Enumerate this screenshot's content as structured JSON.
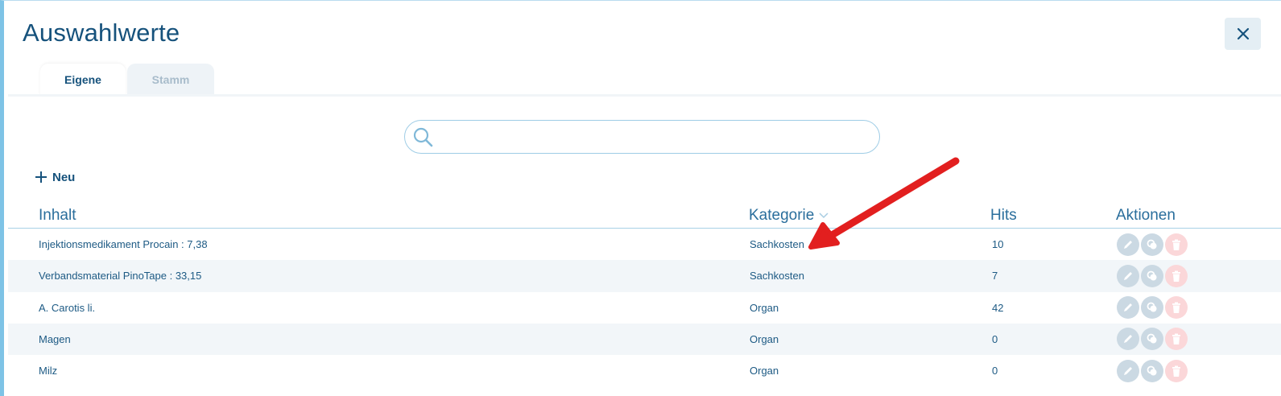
{
  "dialog": {
    "title": "Auswahlwerte",
    "close_icon": "close-icon"
  },
  "tabs": [
    {
      "label": "Eigene",
      "active": true
    },
    {
      "label": "Stamm",
      "active": false
    }
  ],
  "search": {
    "placeholder": "",
    "value": "",
    "icon": "search-icon"
  },
  "toolbar": {
    "new_label": "Neu",
    "new_icon": "plus-icon"
  },
  "table": {
    "columns": {
      "inhalt": "Inhalt",
      "kategorie": "Kategorie",
      "hits": "Hits",
      "aktionen": "Aktionen"
    },
    "sort_icon": "chevron-down-icon",
    "rows": [
      {
        "inhalt": "Injektionsmedikament Procain  : 7,38",
        "kategorie": "Sachkosten",
        "hits": "10"
      },
      {
        "inhalt": "Verbandsmaterial PinoTape : 33,15",
        "kategorie": "Sachkosten",
        "hits": "7"
      },
      {
        "inhalt": "A. Carotis li.",
        "kategorie": "Organ",
        "hits": "42"
      },
      {
        "inhalt": "Magen",
        "kategorie": "Organ",
        "hits": "0"
      },
      {
        "inhalt": "Milz",
        "kategorie": "Organ",
        "hits": "0"
      }
    ],
    "action_icons": [
      "pencil-icon",
      "copy-icon",
      "trash-icon"
    ]
  },
  "colors": {
    "primary": "#16527c",
    "accent": "#7ec3e6",
    "annotation_arrow": "#e21f1f"
  }
}
